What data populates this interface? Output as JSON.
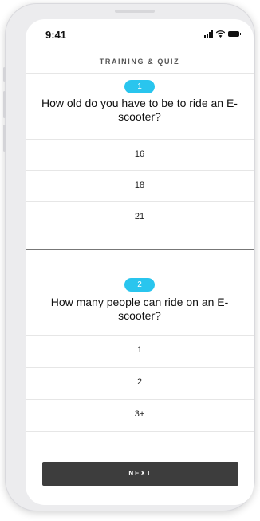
{
  "status_bar": {
    "time": "9:41"
  },
  "header": {
    "title": "TRAINING & QUIZ"
  },
  "questions": [
    {
      "number": "1",
      "text": "How old do you have to be to ride an E-scooter?",
      "options": [
        "16",
        "18",
        "21"
      ]
    },
    {
      "number": "2",
      "text": "How many people can ride on an E-scooter?",
      "options": [
        "1",
        "2",
        "3+"
      ]
    }
  ],
  "footer": {
    "next_label": "NEXT"
  },
  "colors": {
    "accent": "#29c5ee",
    "button": "#3d3d3d"
  }
}
